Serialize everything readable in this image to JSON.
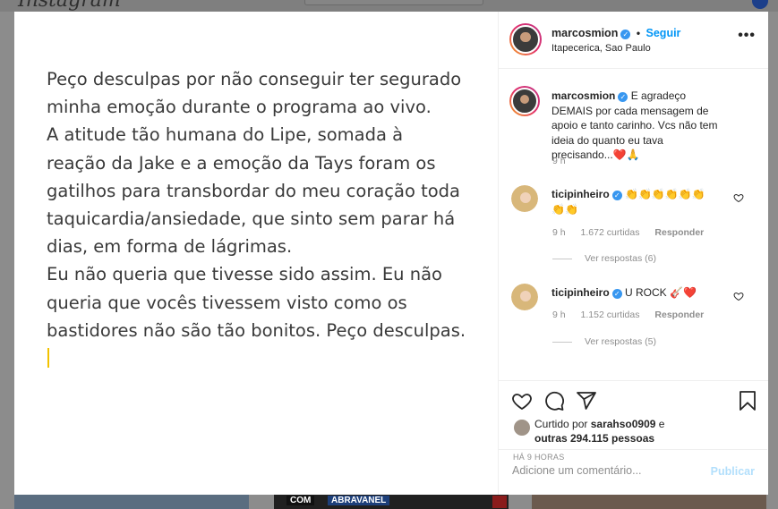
{
  "background": {
    "logo_text": "Instagram",
    "thumb_tags": [
      "COM",
      "ABRAVANEL"
    ]
  },
  "post": {
    "image_text": "Peço desculpas por não conseguir ter segurado minha emoção durante o programa ao vivo.\nA atitude tão humana do Lipe, somada à reação da Jake e a emoção da Tays foram os gatilhos para transbordar do meu coração toda taquicardia/ansiedade, que sinto sem parar há dias, em forma de lágrimas.\nEu não queria que tivesse sido assim. Eu não queria que vocês tivessem visto como os bastidores não são tão bonitos. Peço desculpas."
  },
  "header": {
    "username": "marcosmion",
    "verified_mark": "✓",
    "dot": "•",
    "follow_label": "Seguir",
    "location": "Itapecerica, Sao Paulo",
    "more_icon": "more-options-icon"
  },
  "comments": [
    {
      "username": "marcosmion",
      "text": "E agradeço DEMAIS por cada mensagem de apoio e tanto carinho. Vcs não tem ideia do quanto eu tava precisando...❤️🙏",
      "time": "9 h"
    },
    {
      "username": "ticipinheiro",
      "text": "👏👏👏👏👏👏👏👏",
      "time": "9 h",
      "likes": "1.672 curtidas",
      "reply_label": "Responder",
      "view_replies": "Ver respostas (6)"
    },
    {
      "username": "ticipinheiro",
      "text": "U ROCK 🎸❤️",
      "time": "9 h",
      "likes": "1.152 curtidas",
      "reply_label": "Responder",
      "view_replies": "Ver respostas (5)"
    }
  ],
  "actions": {
    "icons": [
      "heart-icon",
      "comment-icon",
      "share-icon",
      "bookmark-icon"
    ],
    "liked_prefix": "Curtido por",
    "liked_user": "sarahso0909",
    "liked_and": "e",
    "liked_others": "outras 294.115 pessoas",
    "time_ago": "HÁ 9 HORAS"
  },
  "add_comment": {
    "placeholder": "Adicione um comentário...",
    "publish_label": "Publicar"
  },
  "colors": {
    "link_blue": "#0095f6",
    "verified_blue": "#3897f0",
    "heart_red": "#ed4956",
    "publish_disabled": "#b2dffc",
    "caret_yellow": "#f2c200"
  }
}
